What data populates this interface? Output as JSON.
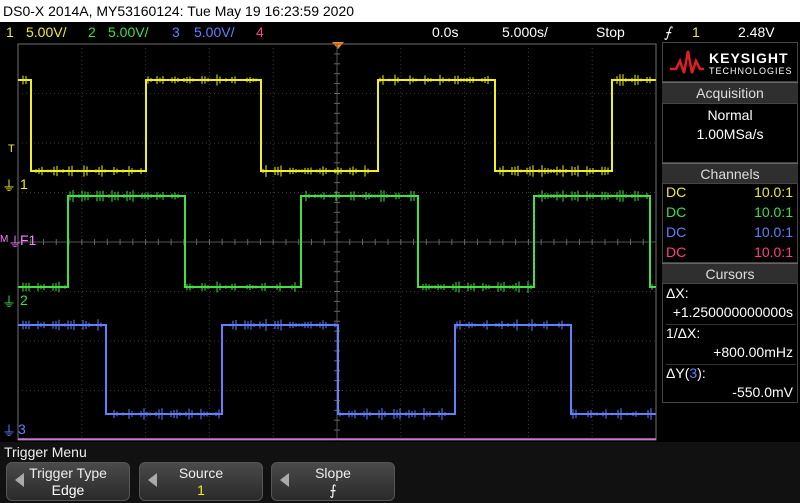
{
  "title": "DS0-X 2014A, MY53160124: Tue May 19 16:23:59 2020",
  "status": {
    "ch1": {
      "num": "1",
      "scale": "5.00V/",
      "color": "#f0f020"
    },
    "ch2": {
      "num": "2",
      "scale": "5.00V/",
      "color": "#40e040"
    },
    "ch3": {
      "num": "3",
      "scale": "5.00V/",
      "color": "#6080ff"
    },
    "ch4": {
      "num": "4",
      "color": "#ff4080"
    },
    "delay": "0.0s",
    "timebase": "5.000s/",
    "run_state": "Stop",
    "trigger_icon": "trigger-edge-icon",
    "trigger_source": "1",
    "trigger_level": "2.48V"
  },
  "screen": {
    "markers": {
      "trigger_level": "T",
      "ch1": "1",
      "ch2": "2",
      "ch3": "3",
      "math": "F1",
      "math_m": "M"
    },
    "math_color": "#ff80ff",
    "trace1_color": "#f0f020",
    "trace2_color": "#40e040",
    "trace3_color": "#6080ff"
  },
  "brand": {
    "name": "KEYSIGHT",
    "sub": "TECHNOLOGIES",
    "logo_color": "#e02020"
  },
  "acquisition": {
    "header": "Acquisition",
    "mode": "Normal",
    "rate": "1.00MSa/s"
  },
  "channels": {
    "header": "Channels",
    "rows": [
      {
        "coupling": "DC",
        "probe": "10.0:1",
        "color": "#f0f020"
      },
      {
        "coupling": "DC",
        "probe": "10.0:1",
        "color": "#40e040"
      },
      {
        "coupling": "DC",
        "probe": "10.0:1",
        "color": "#6080ff"
      },
      {
        "coupling": "DC",
        "probe": "10.0:1",
        "color": "#ff4080"
      }
    ]
  },
  "cursors": {
    "header": "Cursors",
    "dx_label": "ΔX:",
    "dx_value": "+1.250000000000s",
    "inv_dx_label": "1/ΔX:",
    "inv_dx_value": "+800.00mHz",
    "dy_label_pre": "ΔY(",
    "dy_label_ch": "3",
    "dy_label_post": "):",
    "dy_value": "-550.0mV"
  },
  "menu": {
    "title": "Trigger Menu",
    "softkeys": [
      {
        "label": "Trigger Type",
        "value": "Edge",
        "value_color": "#ffffff"
      },
      {
        "label": "Source",
        "value": "1",
        "value_color": "#f0f020"
      },
      {
        "label": "Slope",
        "value": "⨍",
        "value_color": "#ffffff"
      }
    ]
  }
}
